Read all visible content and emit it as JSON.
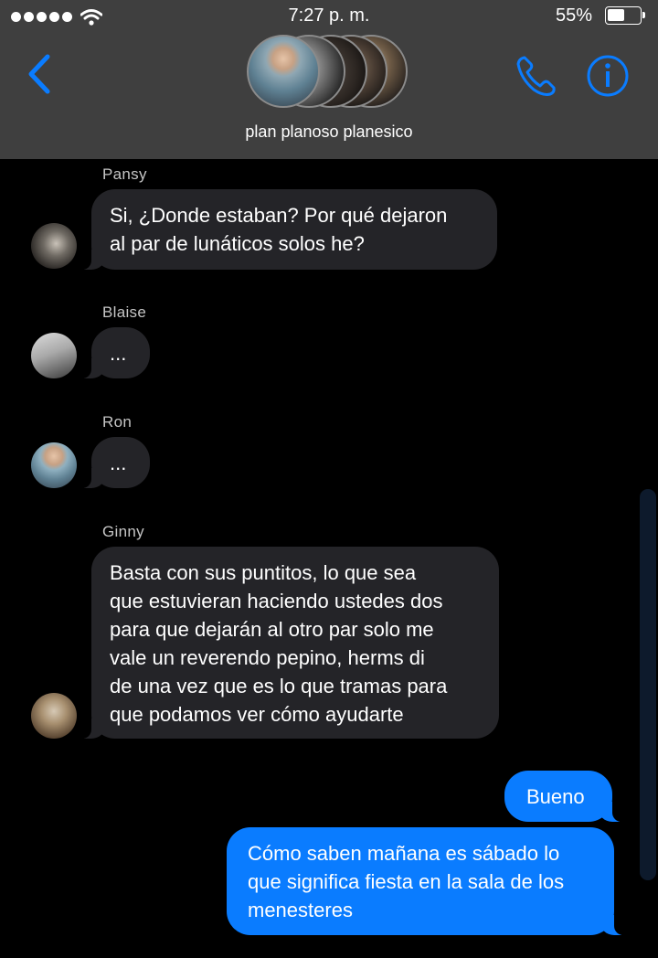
{
  "status_bar": {
    "time": "7:27 p. m.",
    "battery_percent": "55%",
    "battery_level": 0.55,
    "signal_dots": 5
  },
  "header": {
    "group_name": "plan planoso planesico",
    "icons": {
      "back": "chevron-left-icon",
      "call": "phone-icon",
      "info": "info-icon"
    },
    "accent_color": "#0a7cff"
  },
  "messages": [
    {
      "sender": "Pansy",
      "text": "Si, ¿Donde estaban? Por qué dejaron\nal par de lunáticos solos he?",
      "direction": "incoming"
    },
    {
      "sender": "Blaise",
      "text": "...",
      "direction": "incoming"
    },
    {
      "sender": "Ron",
      "text": "...",
      "direction": "incoming"
    },
    {
      "sender": "Ginny",
      "text": "Basta con sus puntitos, lo que sea\nque estuvieran haciendo ustedes dos\npara que dejarán al otro par solo me\nvale un reverendo pepino, herms di\nde una vez que es lo que tramas para\nque podamos ver cómo ayudarte",
      "direction": "incoming"
    },
    {
      "text": "Bueno",
      "direction": "outgoing"
    },
    {
      "text": "Cómo saben mañana es sábado lo\nque significa fiesta en la sala de los\nmenesteres",
      "direction": "outgoing"
    }
  ]
}
